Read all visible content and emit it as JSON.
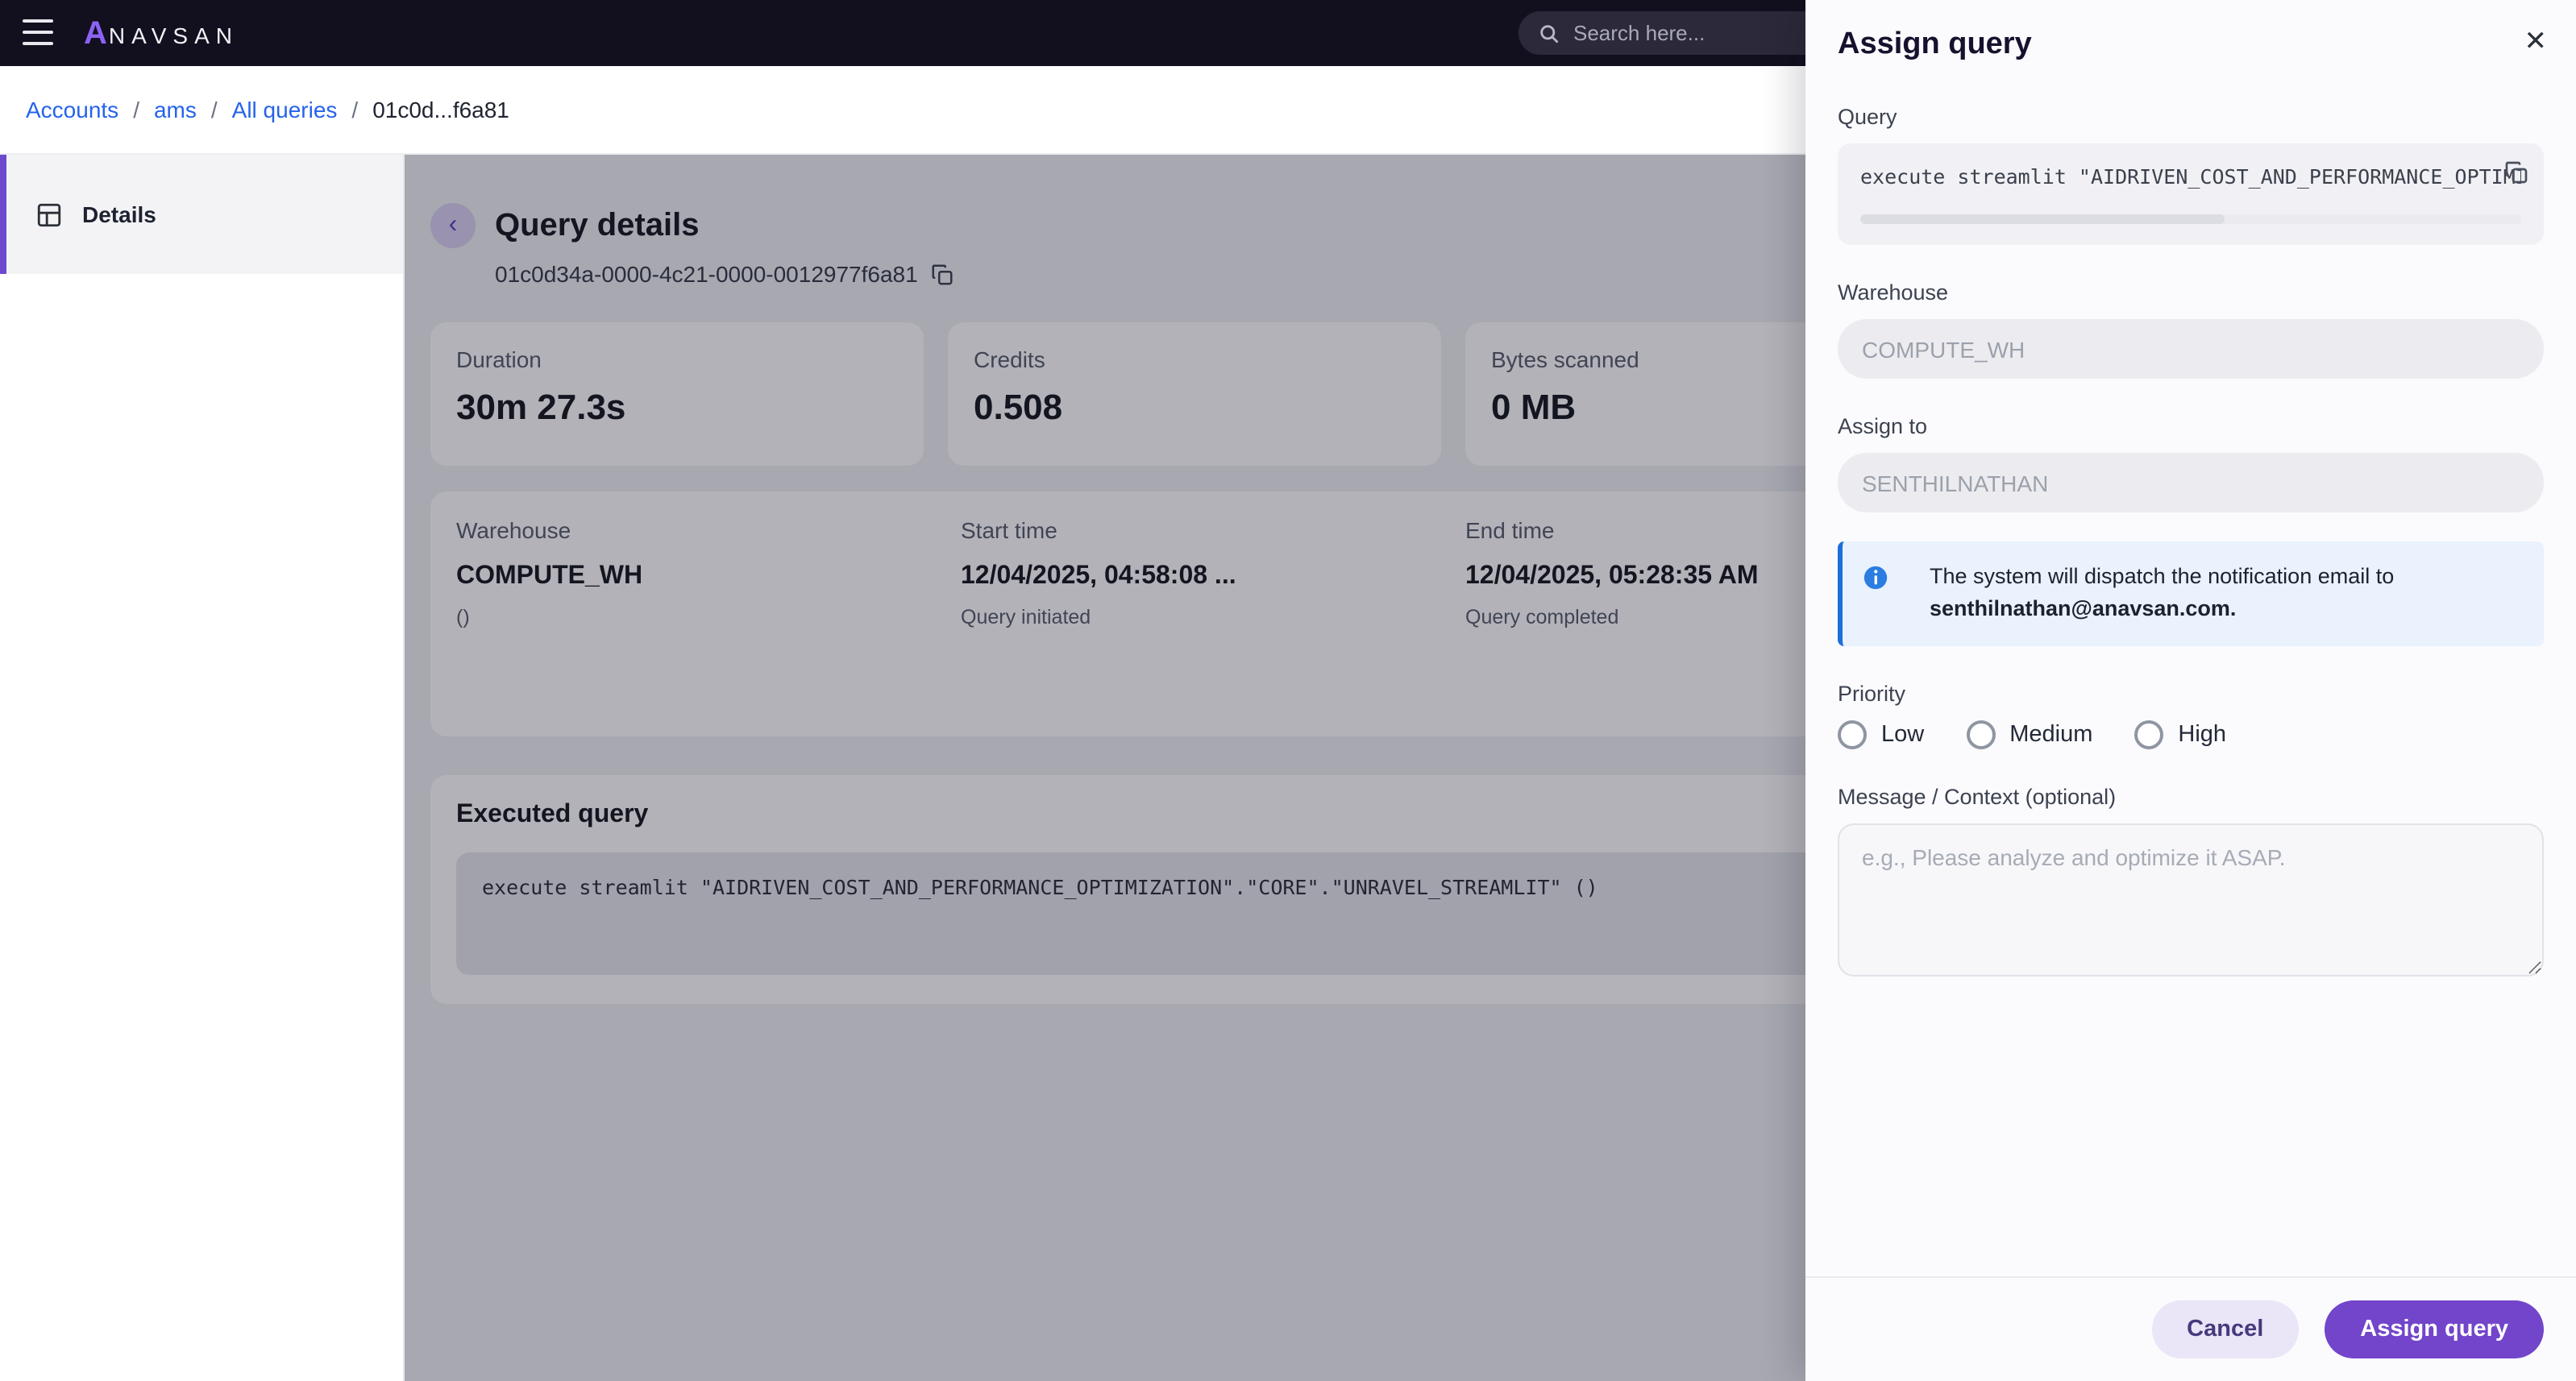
{
  "topbar": {
    "logo_mark": "A",
    "logo_text": "NAVSAN",
    "search_placeholder": "Search here..."
  },
  "breadcrumb": {
    "separator": "/",
    "items": [
      {
        "label": "Accounts"
      },
      {
        "label": "ams"
      },
      {
        "label": "All queries"
      },
      {
        "label": "01c0d...f6a81"
      }
    ]
  },
  "sidebar": {
    "items": [
      {
        "label": "Details",
        "selected": true
      }
    ]
  },
  "main": {
    "title": "Query details",
    "query_id": "01c0d34a-0000-4c21-0000-0012977f6a81",
    "stats": [
      {
        "label": "Duration",
        "value": "30m 27.3s"
      },
      {
        "label": "Credits",
        "value": "0.508"
      },
      {
        "label": "Bytes scanned",
        "value": "0 MB"
      }
    ],
    "details": [
      {
        "label": "Warehouse",
        "value": "COMPUTE_WH",
        "sub": "()"
      },
      {
        "label": "Start time",
        "value": "12/04/2025, 04:58:08 ...",
        "sub": "Query initiated"
      },
      {
        "label": "End time",
        "value": "12/04/2025, 05:28:35 AM",
        "sub": "Query completed"
      }
    ],
    "executed_query": {
      "title": "Executed query",
      "code": "execute streamlit \"AIDRIVEN_COST_AND_PERFORMANCE_OPTIMIZATION\".\"CORE\".\"UNRAVEL_STREAMLIT\" ()"
    }
  },
  "drawer": {
    "title": "Assign query",
    "close_glyph": "✕",
    "query": {
      "label": "Query",
      "code": "execute streamlit \"AIDRIVEN_COST_AND_PERFORMANCE_OPTIMIZATION\".\"CORE\".\"UNRAVEL_STREAMLIT\" ()"
    },
    "warehouse": {
      "label": "Warehouse",
      "value": "COMPUTE_WH"
    },
    "assign_to": {
      "label": "Assign to",
      "value": "SENTHILNATHAN"
    },
    "notice": {
      "text": "The system will dispatch the notification email to",
      "email": "senthilnathan@anavsan.com."
    },
    "priority": {
      "label": "Priority",
      "options": [
        "Low",
        "Medium",
        "High"
      ]
    },
    "message": {
      "label": "Message / Context (optional)",
      "placeholder": "e.g., Please analyze and optimize it ASAP."
    },
    "actions": {
      "cancel": "Cancel",
      "submit": "Assign query"
    }
  },
  "colors": {
    "accent_purple": "#7245cb",
    "link_blue": "#2563eb",
    "info_blue": "#1d6fd8",
    "topbar_dark": "#12101f"
  }
}
